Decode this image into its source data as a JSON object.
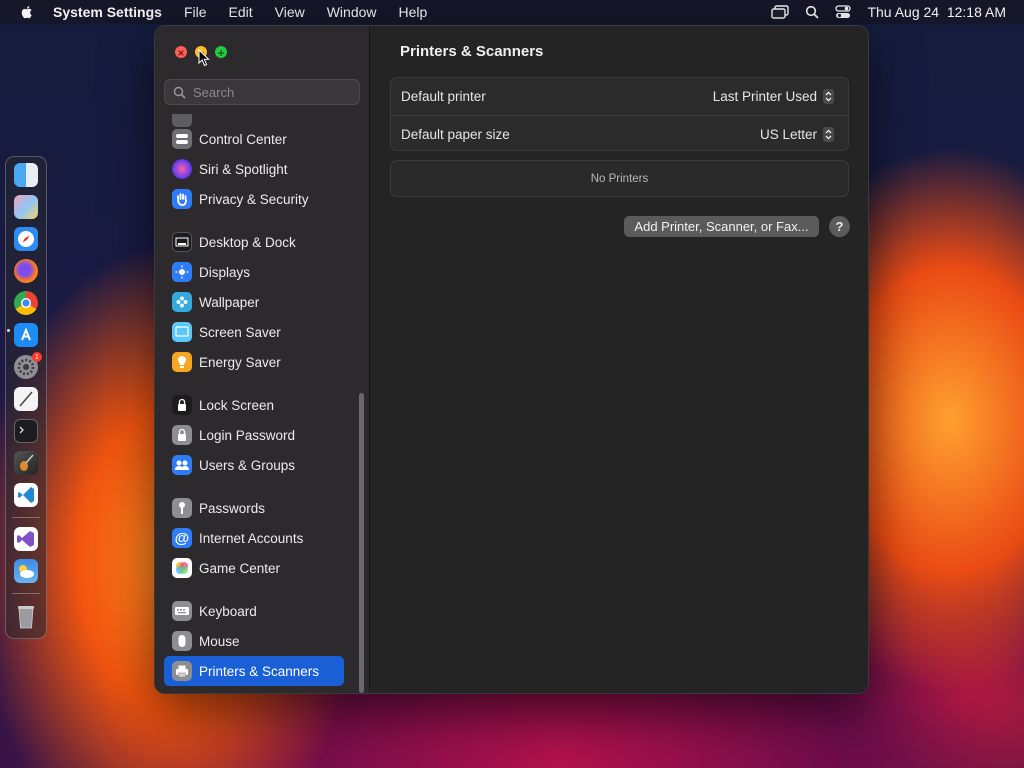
{
  "menubar": {
    "app_name": "System Settings",
    "menus": [
      "File",
      "Edit",
      "View",
      "Window",
      "Help"
    ],
    "clock": "Thu Aug 24  12:18 AM"
  },
  "dock": {
    "apps": [
      "finder-icon",
      "launchpad-icon",
      "safari-icon",
      "firefox-icon",
      "chrome-icon",
      "app-store-icon",
      "system-settings-icon",
      "textedit-icon",
      "terminal-icon",
      "garageband-icon",
      "vscode-icon",
      "visual-studio-icon",
      "weather-icon",
      "trash-icon"
    ],
    "settings_badge": "1"
  },
  "sidebar": {
    "search_placeholder": "Search",
    "items": [
      {
        "label": "Control Center",
        "icon": "control-center-icon",
        "color": "#6e6e73"
      },
      {
        "label": "Siri & Spotlight",
        "icon": "siri-icon",
        "color": "#8b3fd9"
      },
      {
        "label": "Privacy & Security",
        "icon": "hand-icon",
        "color": "#2f7cf6"
      },
      {
        "label": "Desktop & Dock",
        "icon": "dock-icon",
        "color": "#1c1c1e"
      },
      {
        "label": "Displays",
        "icon": "sun-icon",
        "color": "#2f7cf6"
      },
      {
        "label": "Wallpaper",
        "icon": "flower-icon",
        "color": "#34aadc"
      },
      {
        "label": "Screen Saver",
        "icon": "screen-saver-icon",
        "color": "#5ac8fa"
      },
      {
        "label": "Energy Saver",
        "icon": "bulb-icon",
        "color": "#f5a623"
      },
      {
        "label": "Lock Screen",
        "icon": "lock-icon",
        "color": "#1c1c1e"
      },
      {
        "label": "Login Password",
        "icon": "lock-icon",
        "color": "#8e8e93"
      },
      {
        "label": "Users & Groups",
        "icon": "users-icon",
        "color": "#2f7cf6"
      },
      {
        "label": "Passwords",
        "icon": "key-icon",
        "color": "#8e8e93"
      },
      {
        "label": "Internet Accounts",
        "icon": "at-icon",
        "color": "#2f7cf6"
      },
      {
        "label": "Game Center",
        "icon": "game-center-icon",
        "color": "#ffffff"
      },
      {
        "label": "Keyboard",
        "icon": "keyboard-icon",
        "color": "#8e8e93"
      },
      {
        "label": "Mouse",
        "icon": "mouse-icon",
        "color": "#8e8e93"
      },
      {
        "label": "Printers & Scanners",
        "icon": "printer-icon",
        "color": "#8e8e93"
      }
    ],
    "selected": "Printers & Scanners"
  },
  "content": {
    "title": "Printers & Scanners",
    "rows": [
      {
        "label": "Default printer",
        "value": "Last Printer Used"
      },
      {
        "label": "Default paper size",
        "value": "US Letter"
      }
    ],
    "empty_text": "No Printers",
    "add_button": "Add Printer, Scanner, or Fax...",
    "help_button": "?"
  },
  "colors": {
    "accent": "#1a5fd6",
    "close": "#ff5f57",
    "minimize": "#febc2e",
    "zoom": "#28c840"
  }
}
